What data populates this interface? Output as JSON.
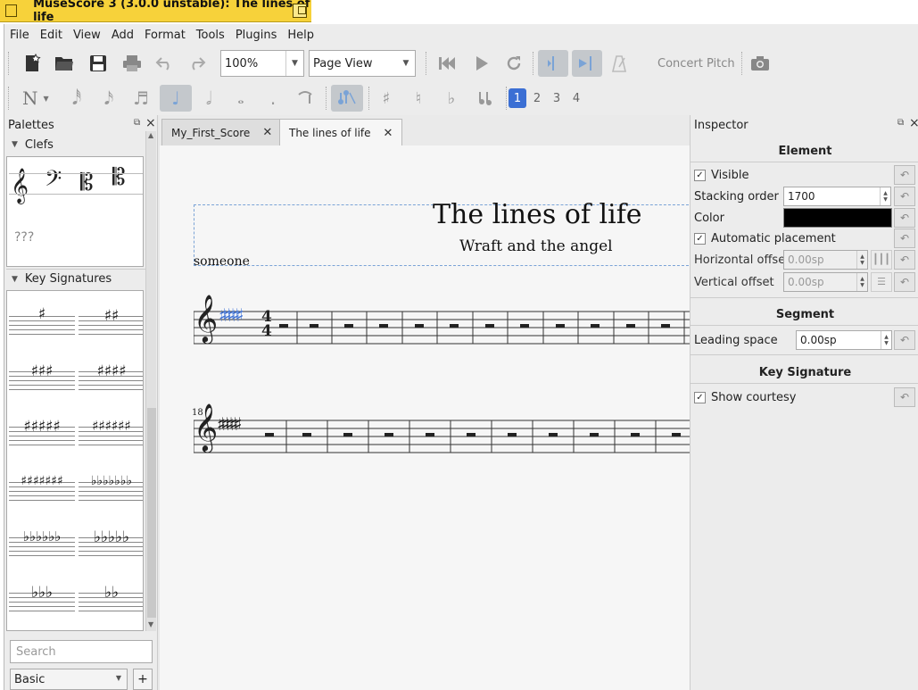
{
  "window": {
    "title": "MuseScore 3 (3.0.0 unstable): The lines of life"
  },
  "menu": [
    "File",
    "Edit",
    "View",
    "Add",
    "Format",
    "Tools",
    "Plugins",
    "Help"
  ],
  "toolbar": {
    "zoom": "100%",
    "view_mode": "Page View",
    "concert_pitch": "Concert Pitch"
  },
  "voices": [
    "1",
    "2",
    "3",
    "4"
  ],
  "palettes": {
    "title": "Palettes",
    "sections": {
      "clefs": "Clefs",
      "keysig": "Key Signatures"
    },
    "clef_unknown": "???",
    "search_placeholder": "Search",
    "workspace": "Basic"
  },
  "tabs": [
    {
      "label": "My_First_Score"
    },
    {
      "label": "The lines of life"
    }
  ],
  "score": {
    "title": "The lines of life",
    "subtitle": "Wraft and the angel",
    "composer": "someone",
    "time_sig": [
      "4",
      "4"
    ],
    "measure_number": "18"
  },
  "inspector": {
    "title": "Inspector",
    "element_header": "Element",
    "visible": "Visible",
    "stacking_label": "Stacking order",
    "stacking_value": "1700",
    "color_label": "Color",
    "color_value": "#000000",
    "auto_placement": "Automatic placement",
    "h_offset_label": "Horizontal offset",
    "h_offset_value": "0.00sp",
    "v_offset_label": "Vertical offset",
    "v_offset_value": "0.00sp",
    "segment_header": "Segment",
    "leading_label": "Leading space",
    "leading_value": "0.00sp",
    "keysig_header": "Key Signature",
    "show_courtesy": "Show courtesy"
  },
  "colors": {
    "title_bar": "#f7d23a",
    "selection_blue": "#3b6fd4"
  }
}
